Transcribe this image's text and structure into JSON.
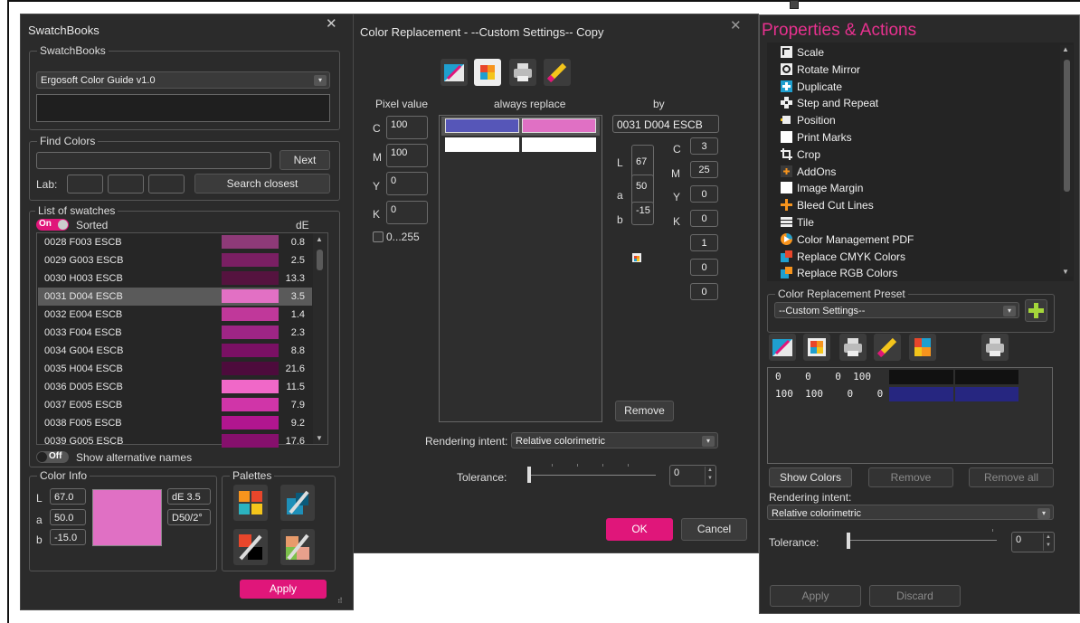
{
  "swatchbooks": {
    "title": "SwatchBooks",
    "group_label": "SwatchBooks",
    "book": "Ergosoft Color Guide v1.0",
    "find": {
      "label": "Find Colors",
      "next": "Next",
      "lab_label": "Lab:",
      "search_closest": "Search closest"
    },
    "list": {
      "label": "List of swatches",
      "toggle": "On",
      "sorted": "Sorted",
      "de_header": "dE",
      "rows": [
        {
          "name": "0028 F003 ESCB",
          "color": "#8e3a78",
          "de": "0.8"
        },
        {
          "name": "0029 G003 ESCB",
          "color": "#7a1f63",
          "de": "2.5"
        },
        {
          "name": "0030 H003 ESCB",
          "color": "#55133f",
          "de": "13.3"
        },
        {
          "name": "0031 D004 ESCB",
          "color": "#e270c4",
          "de": "3.5"
        },
        {
          "name": "0032 E004 ESCB",
          "color": "#c0389a",
          "de": "1.4"
        },
        {
          "name": "0033 F004 ESCB",
          "color": "#9e2585",
          "de": "2.3"
        },
        {
          "name": "0034 G004 ESCB",
          "color": "#7a1064",
          "de": "8.8"
        },
        {
          "name": "0035 H004 ESCB",
          "color": "#4d0b3c",
          "de": "21.6"
        },
        {
          "name": "0036 D005 ESCB",
          "color": "#f068c8",
          "de": "11.5"
        },
        {
          "name": "0037 E005 ESCB",
          "color": "#d035a8",
          "de": "7.9"
        },
        {
          "name": "0038 F005 ESCB",
          "color": "#b1168f",
          "de": "9.2"
        },
        {
          "name": "0039 G005 ESCB",
          "color": "#86106d",
          "de": "17.6"
        }
      ],
      "alt_toggle": "Off",
      "alt_names": "Show alternative names"
    },
    "color_info": {
      "label": "Color Info",
      "L_label": "L",
      "L": "67.0",
      "a_label": "a",
      "a": "50.0",
      "b_label": "b",
      "b": "-15.0",
      "de": "dE 3.5",
      "illuminant": "D50/2°",
      "color": "#e070c4"
    },
    "palettes_label": "Palettes",
    "apply": "Apply"
  },
  "replacement": {
    "title": "Color Replacement - --Custom Settings-- Copy",
    "pixel_value": "Pixel value",
    "always_replace": "always replace",
    "by": "by",
    "C_label": "C",
    "C": "100",
    "M_label": "M",
    "M": "100",
    "Y_label": "Y",
    "Y": "0",
    "K_label": "K",
    "K": "0",
    "range": "0...255",
    "by_name": "0031 D004 ESCB",
    "L_label": "L",
    "L": "67",
    "a_label": "a",
    "a": "50",
    "b_label": "b",
    "b": "-15",
    "c2_label": "C",
    "c2": "3",
    "m2_label": "M",
    "m2": "25",
    "y2_label": "Y",
    "y2": "0",
    "k2_label": "K",
    "k2": "0",
    "extra1": "1",
    "extra2": "0",
    "extra3": "0",
    "remove": "Remove",
    "rendering_label": "Rendering intent:",
    "rendering": "Relative colorimetric",
    "tolerance_label": "Tolerance:",
    "tolerance": "0",
    "ok": "OK",
    "cancel": "Cancel"
  },
  "properties": {
    "title": "Properties & Actions",
    "items": [
      {
        "label": "Scale",
        "icon": "scale-icon"
      },
      {
        "label": "Rotate Mirror",
        "icon": "rotate-icon"
      },
      {
        "label": "Duplicate",
        "icon": "duplicate-icon"
      },
      {
        "label": "Step and Repeat",
        "icon": "step-repeat-icon"
      },
      {
        "label": "Position",
        "icon": "position-icon"
      },
      {
        "label": "Print Marks",
        "icon": "print-marks-icon"
      },
      {
        "label": "Crop",
        "icon": "crop-icon"
      },
      {
        "label": "AddOns",
        "icon": "addons-icon"
      },
      {
        "label": "Image Margin",
        "icon": "margin-icon"
      },
      {
        "label": "Bleed Cut Lines",
        "icon": "bleed-icon"
      },
      {
        "label": "Tile",
        "icon": "tile-icon"
      },
      {
        "label": "Color Management PDF",
        "icon": "color-management-icon"
      },
      {
        "label": "Replace CMYK Colors",
        "icon": "replace-cmyk-icon"
      },
      {
        "label": "Replace RGB Colors",
        "icon": "replace-rgb-icon"
      }
    ],
    "preset_label": "Color Replacement Preset",
    "preset": "--Custom Settings--",
    "rows": [
      {
        "values": "0    0    0  100"
      },
      {
        "values": "100  100    0    0"
      }
    ],
    "show_colors": "Show Colors",
    "remove": "Remove",
    "remove_all": "Remove all",
    "rendering_label": "Rendering intent:",
    "rendering": "Relative colorimetric",
    "tolerance_label": "Tolerance:",
    "tolerance": "0",
    "apply": "Apply",
    "discard": "Discard"
  },
  "colors": {
    "accent": "#e0167a",
    "title_pink": "#e8318f",
    "blue_swatch": "#5656b8",
    "pink_swatch": "#e070c4",
    "navy": "#262680"
  }
}
